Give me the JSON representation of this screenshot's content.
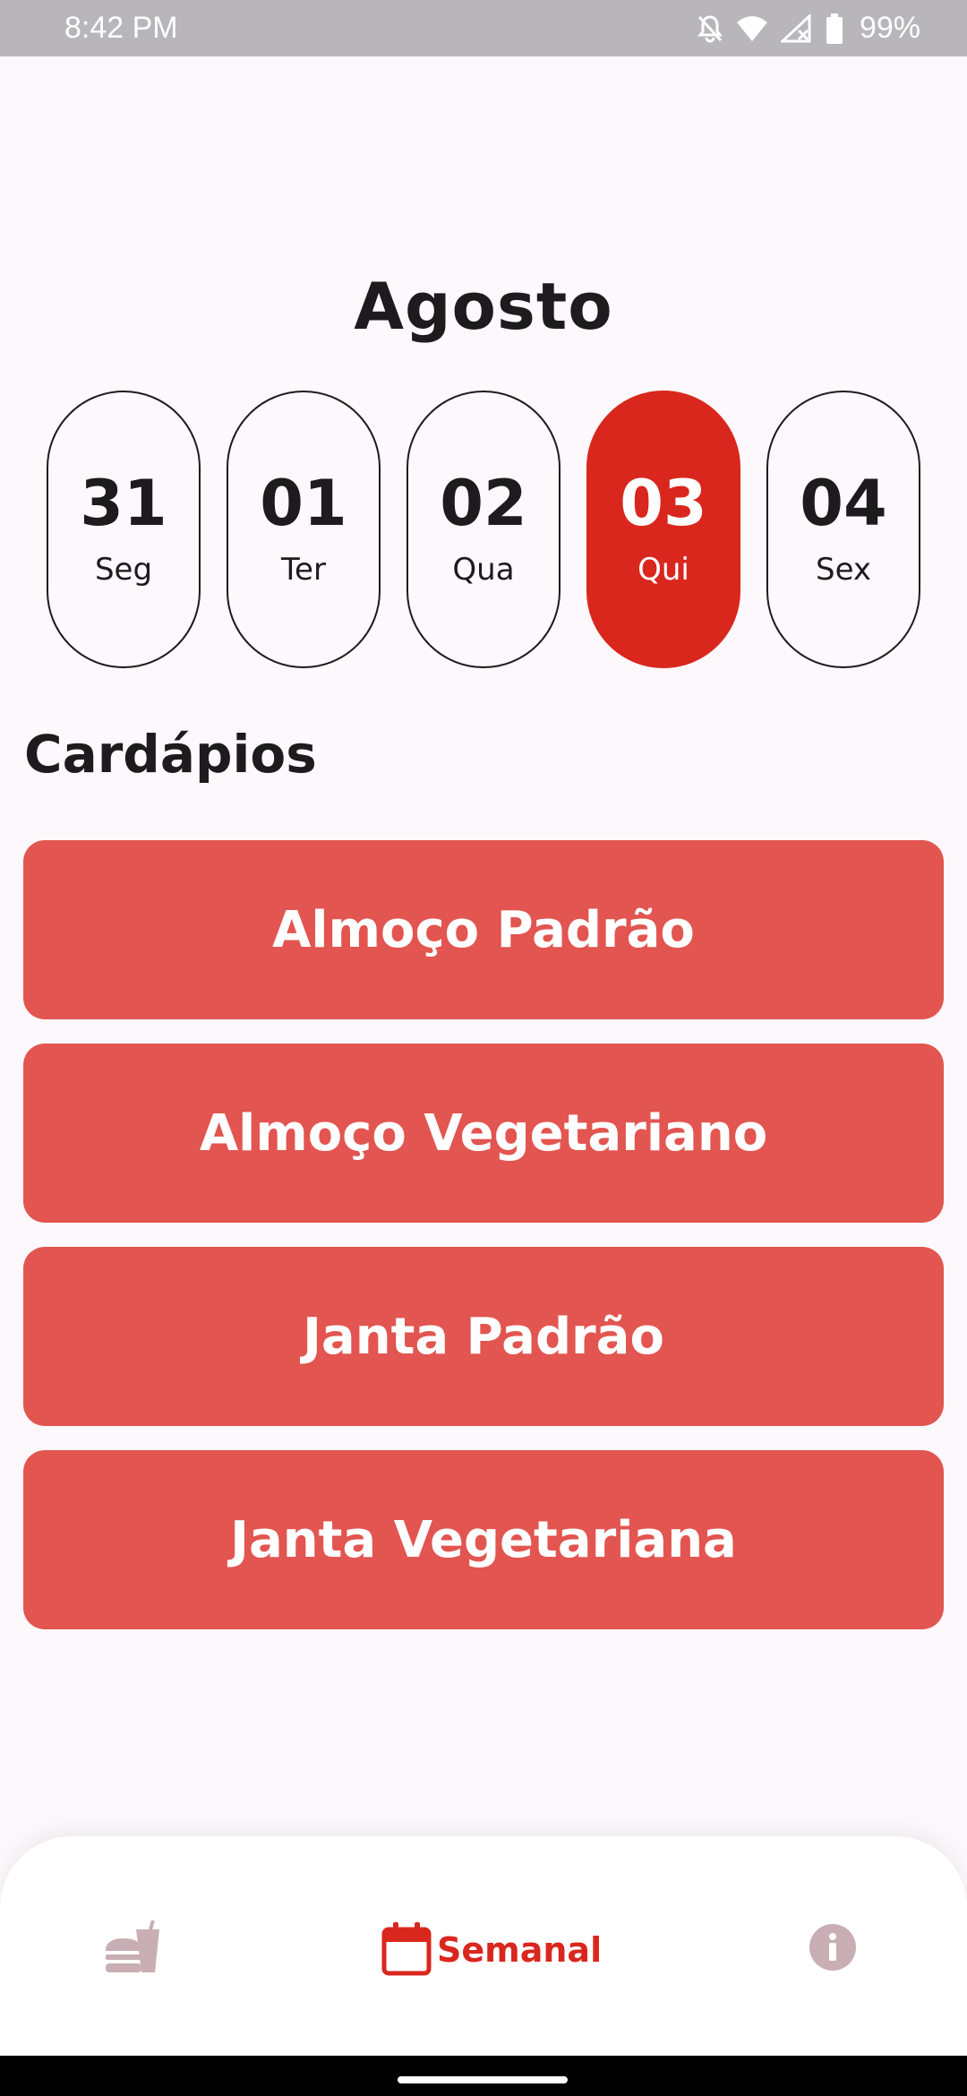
{
  "status_bar": {
    "time": "8:42 PM",
    "battery": "99%",
    "icons": [
      "notifications-off-icon",
      "wifi-icon",
      "no-signal-icon",
      "battery-icon"
    ]
  },
  "calendar": {
    "month": "Agosto",
    "days": [
      {
        "number": "31",
        "name": "Seg",
        "selected": false
      },
      {
        "number": "01",
        "name": "Ter",
        "selected": false
      },
      {
        "number": "02",
        "name": "Qua",
        "selected": false
      },
      {
        "number": "03",
        "name": "Qui",
        "selected": true
      },
      {
        "number": "04",
        "name": "Sex",
        "selected": false
      }
    ]
  },
  "menus": {
    "title": "Cardápios",
    "items": [
      "Almoço Padrão",
      "Almoço Vegetariano",
      "Janta Padrão",
      "Janta Vegetariana"
    ]
  },
  "bottom_nav": {
    "items": [
      {
        "icon": "fastfood-icon",
        "label": "",
        "active": false
      },
      {
        "icon": "calendar-icon",
        "label": "Semanal",
        "active": true
      },
      {
        "icon": "info-icon",
        "label": "",
        "active": false
      }
    ]
  },
  "colors": {
    "accent": "#d9271e",
    "menu_button": "#e25550",
    "background": "#fdf8fb",
    "inactive_icon": "#c9aeb3"
  }
}
